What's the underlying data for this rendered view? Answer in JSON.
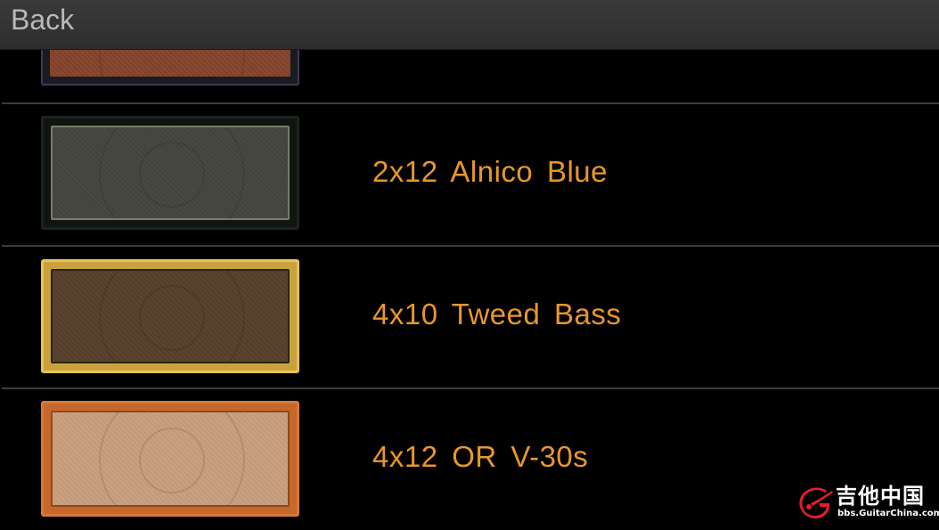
{
  "header": {
    "back_label": "Back"
  },
  "cabinets": [
    {
      "label": "",
      "partial": true
    },
    {
      "label": "2x12  Alnico  Blue"
    },
    {
      "label": "4x10  Tweed  Bass"
    },
    {
      "label": "4x12  OR  V-30s"
    }
  ],
  "colors": {
    "label_color": "#e8962e",
    "background": "#000000",
    "topbar": "#333333",
    "divider": "#3c3c3c"
  },
  "watermark": {
    "title": "吉他中国",
    "url": "bbs.GuitarChina.com"
  }
}
